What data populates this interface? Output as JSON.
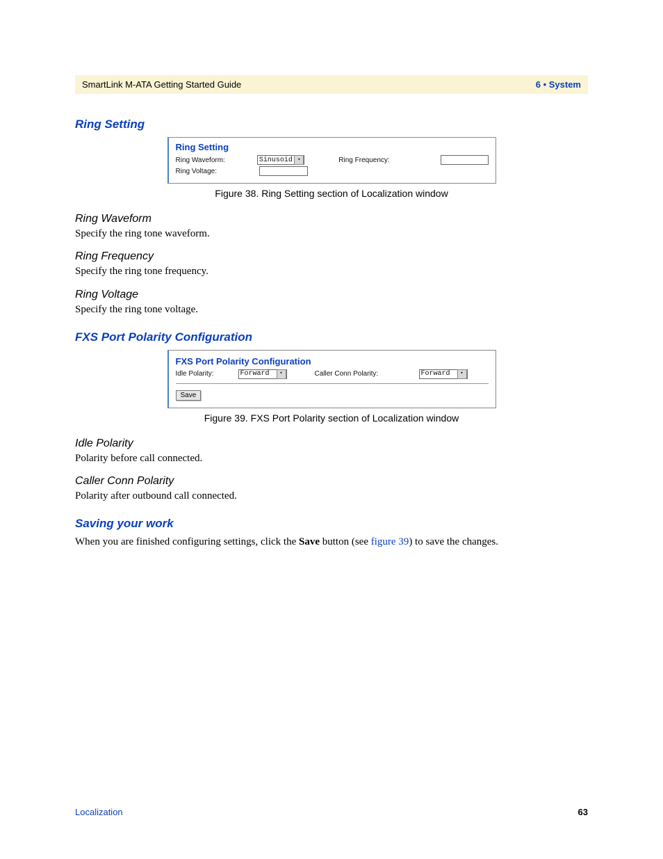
{
  "header": {
    "doc_title": "SmartLink M-ATA Getting Started Guide",
    "chapter": "6 • System"
  },
  "sections": {
    "ring_setting": {
      "heading": "Ring Setting",
      "fig38": {
        "panel_title": "Ring Setting",
        "labels": {
          "waveform": "Ring Waveform:",
          "frequency": "Ring Frequency:",
          "voltage": "Ring Voltage:"
        },
        "values": {
          "waveform_select": "Sinusoid",
          "frequency_input": "",
          "voltage_input": ""
        },
        "caption": "Figure 38. Ring Setting section of Localization window"
      },
      "subs": {
        "waveform": {
          "title": "Ring Waveform",
          "body": "Specify the ring tone waveform."
        },
        "frequency": {
          "title": "Ring Frequency",
          "body": "Specify the ring tone frequency."
        },
        "voltage": {
          "title": "Ring Voltage",
          "body": "Specify the ring tone voltage."
        }
      }
    },
    "fxs": {
      "heading": "FXS Port Polarity Configuration",
      "fig39": {
        "panel_title": "FXS Port Polarity Configuration",
        "labels": {
          "idle": "Idle Polarity:",
          "caller": "Caller Conn Polarity:"
        },
        "values": {
          "idle_select": "Forward",
          "caller_select": "Forward"
        },
        "save_button": "Save",
        "caption": "Figure 39. FXS Port Polarity section of Localization window"
      },
      "subs": {
        "idle": {
          "title": "Idle Polarity",
          "body": "Polarity before call connected."
        },
        "caller": {
          "title": "Caller Conn Polarity",
          "body": "Polarity after outbound call connected."
        }
      }
    },
    "saving": {
      "heading": "Saving your work",
      "body_before": "When you are finished configuring settings, click the ",
      "bold": "Save",
      "body_mid": " button (see ",
      "link": "figure 39",
      "body_after": ") to save the changes."
    }
  },
  "footer": {
    "section": "Localization",
    "page_number": "63"
  }
}
